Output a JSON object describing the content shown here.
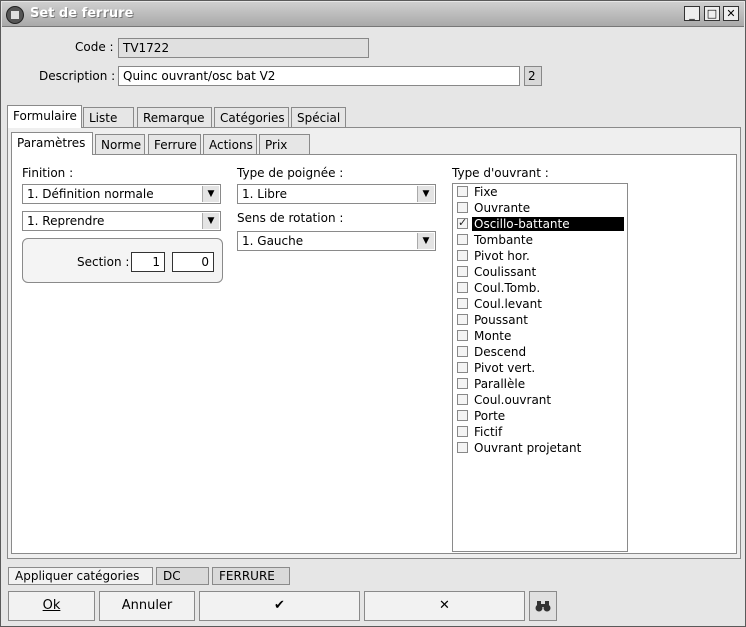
{
  "window": {
    "title": "Set de ferrure"
  },
  "header": {
    "code_label": "Code :",
    "code_value": "TV1722",
    "description_label": "Description :",
    "description_value": "Quinc ouvrant/osc bat V2",
    "description_badge": "2"
  },
  "main_tabs": [
    "Formulaire",
    "Liste",
    "Remarque",
    "Catégories",
    "Spécial"
  ],
  "sub_tabs": [
    "Paramètres",
    "Norme",
    "Ferrure",
    "Actions",
    "Prix"
  ],
  "params": {
    "finition_label": "Finition :",
    "finition_value": "1.  Définition normale",
    "reprendre_value": "1.  Reprendre",
    "section_label": "Section :",
    "section_a": "1",
    "section_b": "0",
    "poignee_label": "Type de poignée :",
    "poignee_value": "1.  Libre",
    "rotation_label": "Sens de rotation :",
    "rotation_value": "1.  Gauche",
    "ouvrant_label": "Type d'ouvrant :",
    "ouvrant_items": [
      {
        "label": "Fixe",
        "checked": false
      },
      {
        "label": "Ouvrante",
        "checked": false
      },
      {
        "label": "Oscillo-battante",
        "checked": true
      },
      {
        "label": "Tombante",
        "checked": false
      },
      {
        "label": "Pivot hor.",
        "checked": false
      },
      {
        "label": "Coulissant",
        "checked": false
      },
      {
        "label": "Coul.Tomb.",
        "checked": false
      },
      {
        "label": "Coul.levant",
        "checked": false
      },
      {
        "label": "Poussant",
        "checked": false
      },
      {
        "label": "Monte",
        "checked": false
      },
      {
        "label": "Descend",
        "checked": false
      },
      {
        "label": "Pivot vert.",
        "checked": false
      },
      {
        "label": "Parallèle",
        "checked": false
      },
      {
        "label": "Coul.ouvrant",
        "checked": false
      },
      {
        "label": "Porte",
        "checked": false
      },
      {
        "label": "Fictif",
        "checked": false
      },
      {
        "label": "Ouvrant projetant",
        "checked": false
      }
    ]
  },
  "status": {
    "apply_label": "Appliquer catégories",
    "chip1": "DC",
    "chip2": "FERRURE"
  },
  "buttons": {
    "ok": "Ok",
    "cancel": "Annuler",
    "check": "✔",
    "cross": "✕",
    "binoculars": "binoculars-icon"
  }
}
